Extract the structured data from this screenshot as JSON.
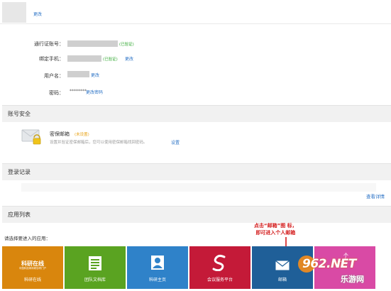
{
  "header": {
    "edit_label": "更改"
  },
  "account": {
    "id_label": "通行证账号：",
    "id_status": "(已验证)",
    "phone_label": "绑定手机：",
    "phone_status": "(已验证)",
    "phone_change": "更改",
    "username_label": "用户名：",
    "username_change": "更改",
    "password_label": "密码：",
    "password_value": "********",
    "password_change": "更改密码"
  },
  "security": {
    "title": "账号安全",
    "mail_title": "密保邮箱",
    "mail_status": "(未设置)",
    "mail_desc": "设置并验证密保邮箱后，您可以使用密保邮箱找回密码。",
    "mail_set": "设置"
  },
  "login": {
    "title": "登录记录",
    "view_details": "查看详情"
  },
  "apps": {
    "title": "应用列表",
    "prompt": "请选择要进入的应用：",
    "logo_main": "科研在线",
    "logo_sub": "中国科技网科研协同门户",
    "tiles": [
      {
        "label": "科研在线",
        "color": "#d9860d"
      },
      {
        "label": "团队文档库",
        "color": "#5aa321"
      },
      {
        "label": "科研主页",
        "color": "#2f82c9"
      },
      {
        "label": "会议服务平台",
        "color": "#c41a38"
      },
      {
        "label": "邮箱",
        "color": "#1f5f98"
      },
      {
        "label": "",
        "color": "#d94aa5"
      }
    ]
  },
  "annotation": {
    "line1": "点击“邮箱”图 标，",
    "line2": "即可进入个人邮箱"
  },
  "watermark": {
    "brand": "962.NET",
    "sub": "乐游网"
  }
}
